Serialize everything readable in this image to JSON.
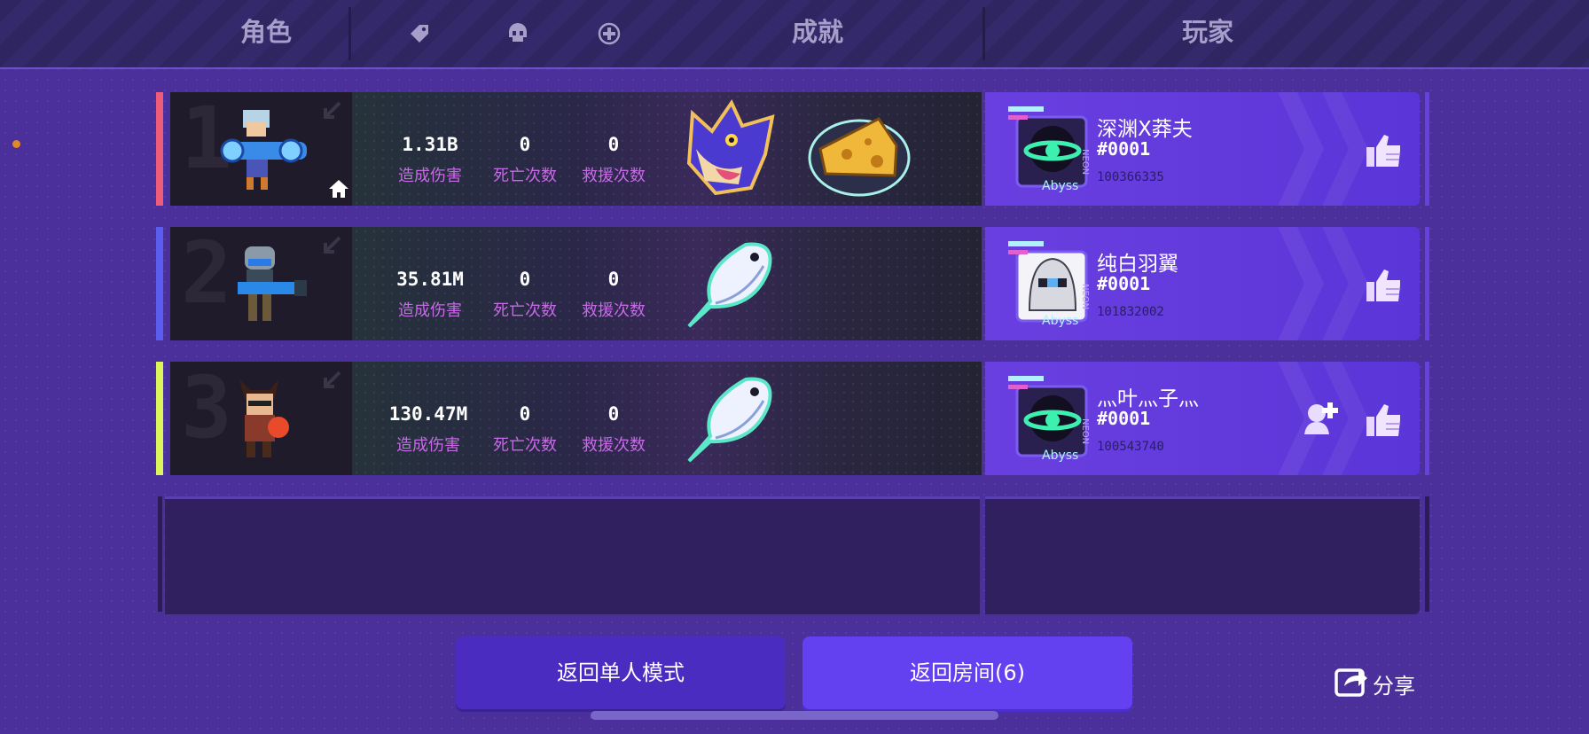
{
  "header": {
    "role_label": "角色",
    "achievements_label": "成就",
    "player_label": "玩家",
    "filter_icons": [
      "tag-icon",
      "skull-icon",
      "plus-circle-icon"
    ]
  },
  "colors": {
    "rank1_accent": "#ee5c7a",
    "rank2_accent": "#5a5df0",
    "rank3_accent": "#dcf55a",
    "stat_label": "#c66ae6",
    "player_panel": "#6a3fe0"
  },
  "rows": [
    {
      "rank": "1",
      "damage": "1.31B",
      "damage_label": "造成伤害",
      "deaths": "0",
      "deaths_label": "死亡次数",
      "rescues": "0",
      "rescues_label": "救援次数",
      "achievements": [
        "wolf-badge-icon",
        "cheese-badge-icon"
      ],
      "player_name": "深渊X莽夫",
      "player_tag": "#0001",
      "player_id": "100366335",
      "avatar_text": "Abyss"
    },
    {
      "rank": "2",
      "damage": "35.81M",
      "damage_label": "造成伤害",
      "deaths": "0",
      "deaths_label": "死亡次数",
      "rescues": "0",
      "rescues_label": "救援次数",
      "achievements": [
        "fish-badge-icon"
      ],
      "player_name": "纯白羽翼",
      "player_tag": "#0001",
      "player_id": "101832002",
      "avatar_text": "Abyss"
    },
    {
      "rank": "3",
      "damage": "130.47M",
      "damage_label": "造成伤害",
      "deaths": "0",
      "deaths_label": "死亡次数",
      "rescues": "0",
      "rescues_label": "救援次数",
      "achievements": [
        "fish-badge-icon"
      ],
      "player_name": "灬叶灬子灬",
      "player_tag": "#0001",
      "player_id": "100543740",
      "avatar_text": "Abyss"
    }
  ],
  "buttons": {
    "back_single": "返回单人模式",
    "back_room": "返回房间(6)",
    "share": "分享"
  }
}
